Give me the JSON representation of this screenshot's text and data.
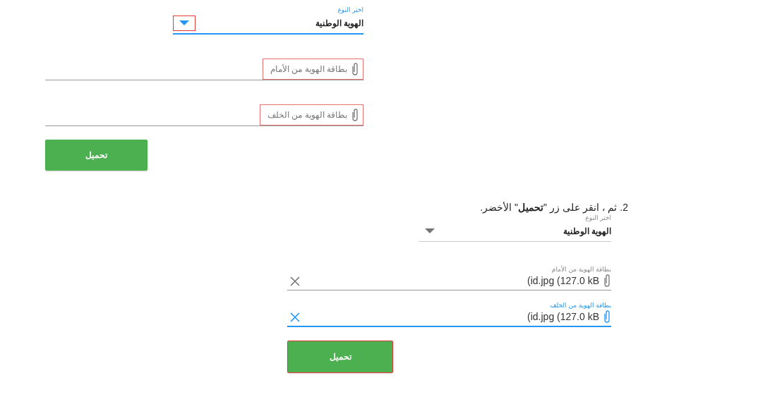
{
  "forms": [
    {
      "select": {
        "label": "اختر النوع",
        "value": "الهوية الوطنية",
        "focused": true,
        "highlighted": true
      },
      "files": [
        {
          "placeholder": "بطاقة الهوية من الأمام",
          "focused": false,
          "highlighted": true
        },
        {
          "placeholder": "بطاقة الهوية من الخلف",
          "focused": false,
          "highlighted": true
        }
      ],
      "button": {
        "label": "تحميل",
        "highlighted": false
      }
    },
    {
      "instruction": "2. ثم ، انقر على زر \"**تحميل**\" الأخضر.",
      "select": {
        "label": "اختر النوع",
        "value": "الهوية الوطنية",
        "focused": false,
        "highlighted": false
      },
      "files": [
        {
          "label": "بطاقة الهوية من الأمام",
          "value": "(id.jpg (127.0 kB",
          "focused": false,
          "highlighted": false
        },
        {
          "label": "بطاقة الهوية من الخلف",
          "value": "(id.jpg (127.0 kB",
          "focused": true,
          "highlighted": false
        }
      ],
      "button": {
        "label": "تحميل",
        "highlighted": true
      }
    }
  ]
}
